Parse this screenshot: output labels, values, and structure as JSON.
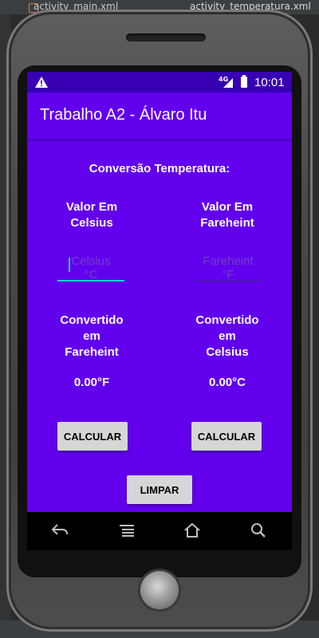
{
  "ide": {
    "tab_activity": "activity_main.xml",
    "tab_temperatura": "activity_temperatura.xml"
  },
  "status_bar": {
    "warning_icon": "warning-icon",
    "network": "4G",
    "time": "10:01"
  },
  "app_bar": {
    "title": "Trabalho A2 - Álvaro Itu"
  },
  "content": {
    "heading": "Conversão Temperatura:",
    "left": {
      "label_line1": "Valor Em",
      "label_line2": "Celsius",
      "input_placeholder_line1": "Celsius",
      "input_placeholder_line2": "°C",
      "result_label_line1": "Convertido",
      "result_label_line2": "em",
      "result_label_line3": "Fareheint",
      "result_value": "0.00°F",
      "button": "CALCULAR"
    },
    "right": {
      "label_line1": "Valor Em",
      "label_line2": "Fareheint",
      "input_placeholder_line1": "Fareheint",
      "input_placeholder_line2": "°F",
      "result_label_line1": "Convertido",
      "result_label_line2": "em",
      "result_label_line3": "Celsius",
      "result_value": "0.00°C",
      "button": "CALCULAR"
    },
    "clear_button": "LIMPAR"
  },
  "nav_bar": {
    "back_icon": "back-icon",
    "menu_icon": "menu-icon",
    "home_icon": "home-icon",
    "search_icon": "search-icon"
  },
  "colors": {
    "primary": "#6200ee",
    "primary_dark": "#3700b3",
    "accent": "#03dac5",
    "button": "#d6d6d6"
  }
}
